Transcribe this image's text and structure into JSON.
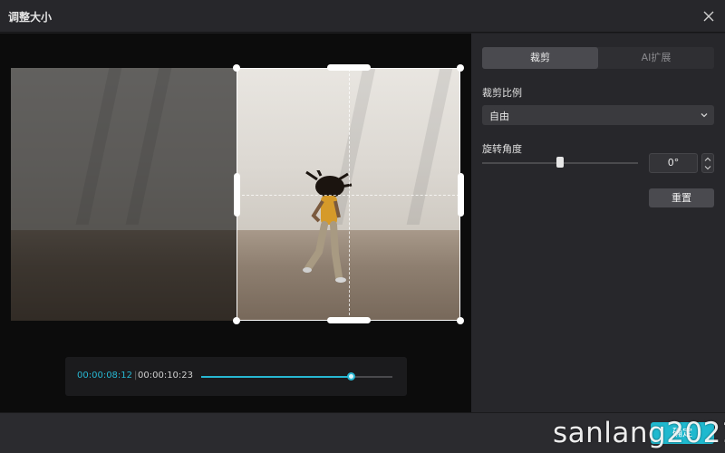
{
  "window": {
    "title": "调整大小",
    "close_icon": "close-icon"
  },
  "player": {
    "current_time": "00:00:08:12",
    "separator": "|",
    "total_time": "00:00:10:23",
    "progress": 0.78,
    "accent": "#27b7d2"
  },
  "panel": {
    "tabs": [
      {
        "label": "裁剪",
        "active": true
      },
      {
        "label": "AI扩展",
        "active": false
      }
    ],
    "crop_ratio_label": "裁剪比例",
    "crop_ratio_value": "自由",
    "rotate_label": "旋转角度",
    "rotate_value": "0°",
    "rotate_slider_position": 0.5,
    "reset_label": "重置"
  },
  "footer": {
    "confirm_label": "确定",
    "confirm_color": "#1fb9cf",
    "watermark": "sanlang2021"
  }
}
